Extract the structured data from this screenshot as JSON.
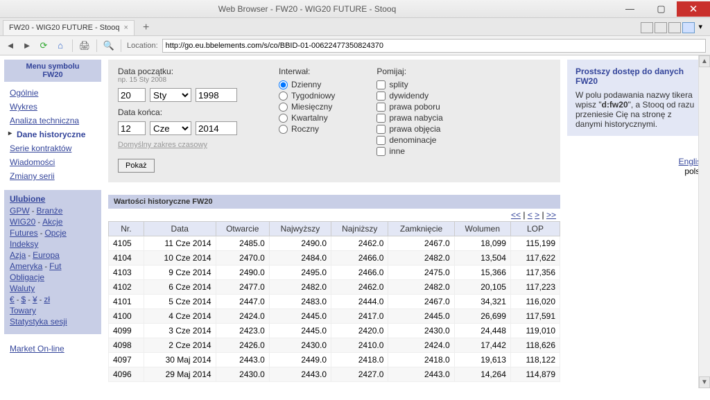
{
  "window": {
    "title": "Web Browser - FW20 - WIG20 FUTURE - Stooq"
  },
  "tab": {
    "label": "FW20 - WIG20 FUTURE - Stooq"
  },
  "nav": {
    "location_label": "Location:",
    "url": "http://go.eu.bbelements.com/s/co/BBID-01-00622477350824370"
  },
  "sidebar": {
    "menu_title": "Menu symbolu",
    "menu_subtitle": "FW20",
    "items": [
      "Ogólnie",
      "Wykres",
      "Analiza techniczna",
      "Dane historyczne",
      "Serie kontraktów",
      "Wiadomości",
      "Zmiany serii"
    ],
    "active_index": 3,
    "fav_header": "Ulubione",
    "fav_rows": [
      [
        "GPW",
        "Branże"
      ],
      [
        "WIG20",
        "Akcje"
      ],
      [
        "Futures",
        "Opcje"
      ],
      [
        "Indeksy"
      ],
      [
        "Azja",
        "Europa"
      ],
      [
        "Ameryka",
        "Fut"
      ],
      [
        "Obligacje"
      ],
      [
        "Waluty"
      ],
      [
        "€",
        "$",
        "¥",
        "zł"
      ],
      [
        "Towary"
      ],
      [
        "Statystyka sesji"
      ]
    ],
    "market_online": "Market On-line"
  },
  "form": {
    "start_label": "Data początku:",
    "start_hint": "np. 15 Sty 2008",
    "start_day": "20",
    "start_month": "Sty",
    "start_year": "1998",
    "end_label": "Data końca:",
    "end_day": "12",
    "end_month": "Cze",
    "end_year": "2014",
    "default_range": "Domyślny zakres czasowy",
    "show_btn": "Pokaż",
    "interval_label": "Interwał:",
    "intervals": [
      "Dzienny",
      "Tygodniowy",
      "Miesięczny",
      "Kwartalny",
      "Roczny"
    ],
    "interval_selected": "Dzienny",
    "skip_label": "Pomijaj:",
    "skips": [
      "splity",
      "dywidendy",
      "prawa poboru",
      "prawa nabycia",
      "prawa objęcia",
      "denominacje",
      "inne"
    ]
  },
  "table": {
    "title": "Wartości historyczne FW20",
    "pager": [
      "<<",
      "<",
      ">",
      ">>"
    ],
    "headers": [
      "Nr.",
      "Data",
      "Otwarcie",
      "Najwyższy",
      "Najniższy",
      "Zamknięcie",
      "Wolumen",
      "LOP"
    ],
    "rows": [
      [
        "4105",
        "11 Cze 2014",
        "2485.0",
        "2490.0",
        "2462.0",
        "2467.0",
        "18,099",
        "115,199"
      ],
      [
        "4104",
        "10 Cze 2014",
        "2470.0",
        "2484.0",
        "2466.0",
        "2482.0",
        "13,504",
        "117,622"
      ],
      [
        "4103",
        "9 Cze 2014",
        "2490.0",
        "2495.0",
        "2466.0",
        "2475.0",
        "15,366",
        "117,356"
      ],
      [
        "4102",
        "6 Cze 2014",
        "2477.0",
        "2482.0",
        "2462.0",
        "2482.0",
        "20,105",
        "117,223"
      ],
      [
        "4101",
        "5 Cze 2014",
        "2447.0",
        "2483.0",
        "2444.0",
        "2467.0",
        "34,321",
        "116,020"
      ],
      [
        "4100",
        "4 Cze 2014",
        "2424.0",
        "2445.0",
        "2417.0",
        "2445.0",
        "26,699",
        "117,591"
      ],
      [
        "4099",
        "3 Cze 2014",
        "2423.0",
        "2445.0",
        "2420.0",
        "2430.0",
        "24,448",
        "119,010"
      ],
      [
        "4098",
        "2 Cze 2014",
        "2426.0",
        "2430.0",
        "2410.0",
        "2424.0",
        "17,442",
        "118,626"
      ],
      [
        "4097",
        "30 Maj 2014",
        "2443.0",
        "2449.0",
        "2418.0",
        "2418.0",
        "19,613",
        "118,122"
      ],
      [
        "4096",
        "29 Maj 2014",
        "2430.0",
        "2443.0",
        "2427.0",
        "2443.0",
        "14,264",
        "114,879"
      ]
    ]
  },
  "info": {
    "header": "Prostszy dostęp do danych FW20",
    "text_pre": "W polu podawania nazwy tikera wpisz \"",
    "bold": "d:fw20",
    "text_post": "\", a Stooq od razu przeniesie Cię na stronę z danymi historycznymi."
  },
  "lang": {
    "en": "English",
    "pl": "polski"
  }
}
